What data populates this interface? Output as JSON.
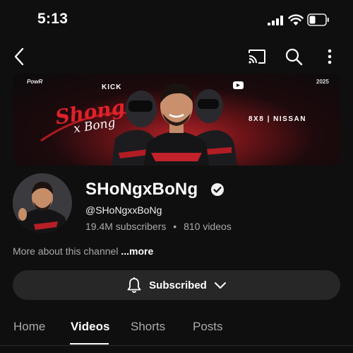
{
  "status_bar": {
    "time": "5:13"
  },
  "channel": {
    "name": "SHoNgxBoNg",
    "handle": "@SHoNgxxBoNg",
    "subscribers": "19.4M subscribers",
    "separator": "•",
    "videos": "810 videos",
    "about_text": "More about this channel ",
    "about_more": "...more"
  },
  "banner": {
    "small_logo": "PowR",
    "kick": "KICK",
    "year": "2025",
    "sponsor": "8X8 | NISSAN",
    "sig_line1": "Shong",
    "sig_line2": "x Bong"
  },
  "subscribe": {
    "label": "Subscribed"
  },
  "tabs": [
    {
      "label": "Home"
    },
    {
      "label": "Videos"
    },
    {
      "label": "Shorts"
    },
    {
      "label": "Posts"
    }
  ],
  "icons": {
    "back": "back-arrow-icon",
    "cast": "cast-icon",
    "search": "search-icon",
    "more": "more-vertical-icon",
    "verified": "verified-check-icon",
    "bell": "bell-icon",
    "chevron": "chevron-down-icon"
  }
}
